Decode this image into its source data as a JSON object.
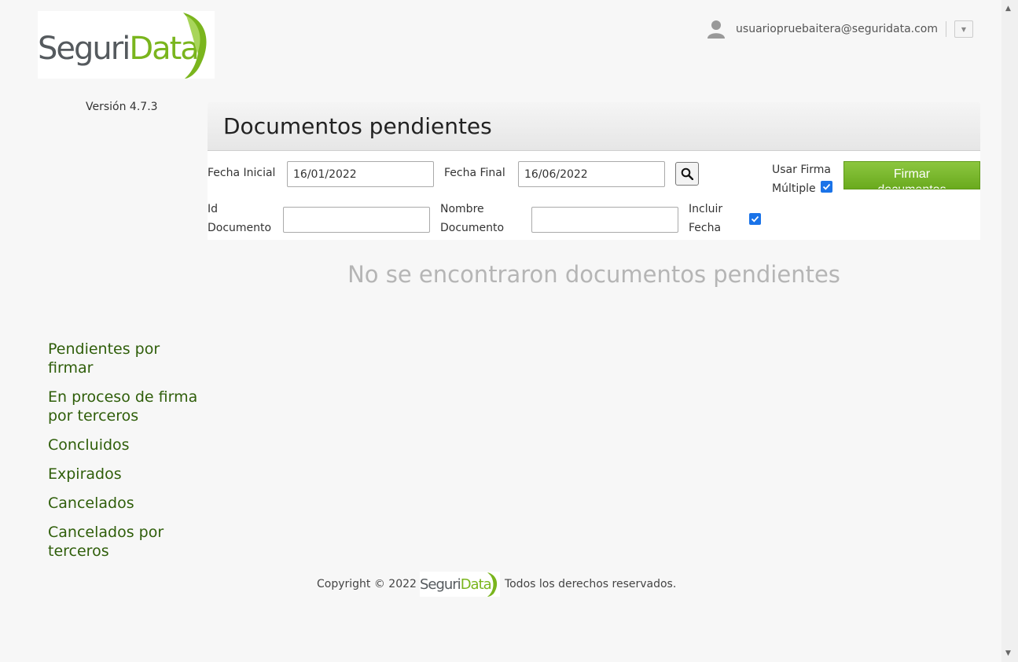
{
  "brand": {
    "logo_part1": "Seguri",
    "logo_part2": "Data",
    "version": "Versión 4.7.3"
  },
  "user": {
    "email": "usuariopruebaitera@seguridata.com",
    "avatar_icon": "user-icon",
    "menu_icon": "chevron-down-icon"
  },
  "panel": {
    "title": "Documentos pendientes",
    "fecha_inicial_label": "Fecha Inicial",
    "fecha_inicial_value": "16/01/2022",
    "fecha_final_label": "Fecha Final",
    "fecha_final_value": "16/06/2022",
    "search_icon": "search-icon",
    "usar_firma_label_1": "Usar Firma",
    "usar_firma_label_2": "Múltiple",
    "usar_firma_checked": true,
    "sign_button_label": "Firmar documentos",
    "id_doc_label_1": "Id",
    "id_doc_label_2": "Documento",
    "id_doc_value": "",
    "nombre_doc_label_1": "Nombre",
    "nombre_doc_label_2": "Documento",
    "nombre_doc_value": "",
    "incluir_fecha_label_1": "Incluir",
    "incluir_fecha_label_2": "Fecha",
    "incluir_fecha_checked": true,
    "empty_message": "No se encontraron documentos pendientes"
  },
  "sidebar": {
    "items": [
      {
        "label": "Pendientes por firmar"
      },
      {
        "label": "En proceso de firma por terceros"
      },
      {
        "label": "Concluidos"
      },
      {
        "label": "Expirados"
      },
      {
        "label": "Cancelados"
      },
      {
        "label": "Cancelados por terceros"
      }
    ]
  },
  "footer": {
    "copyright": "Copyright © 2022",
    "logo_part1": "Seguri",
    "logo_part2": "Data",
    "rights": "Todos los derechos reservados."
  },
  "colors": {
    "accent_green": "#7ab51d",
    "sidebar_link": "#2f5e0a",
    "checkbox_blue": "#1a73e8"
  }
}
